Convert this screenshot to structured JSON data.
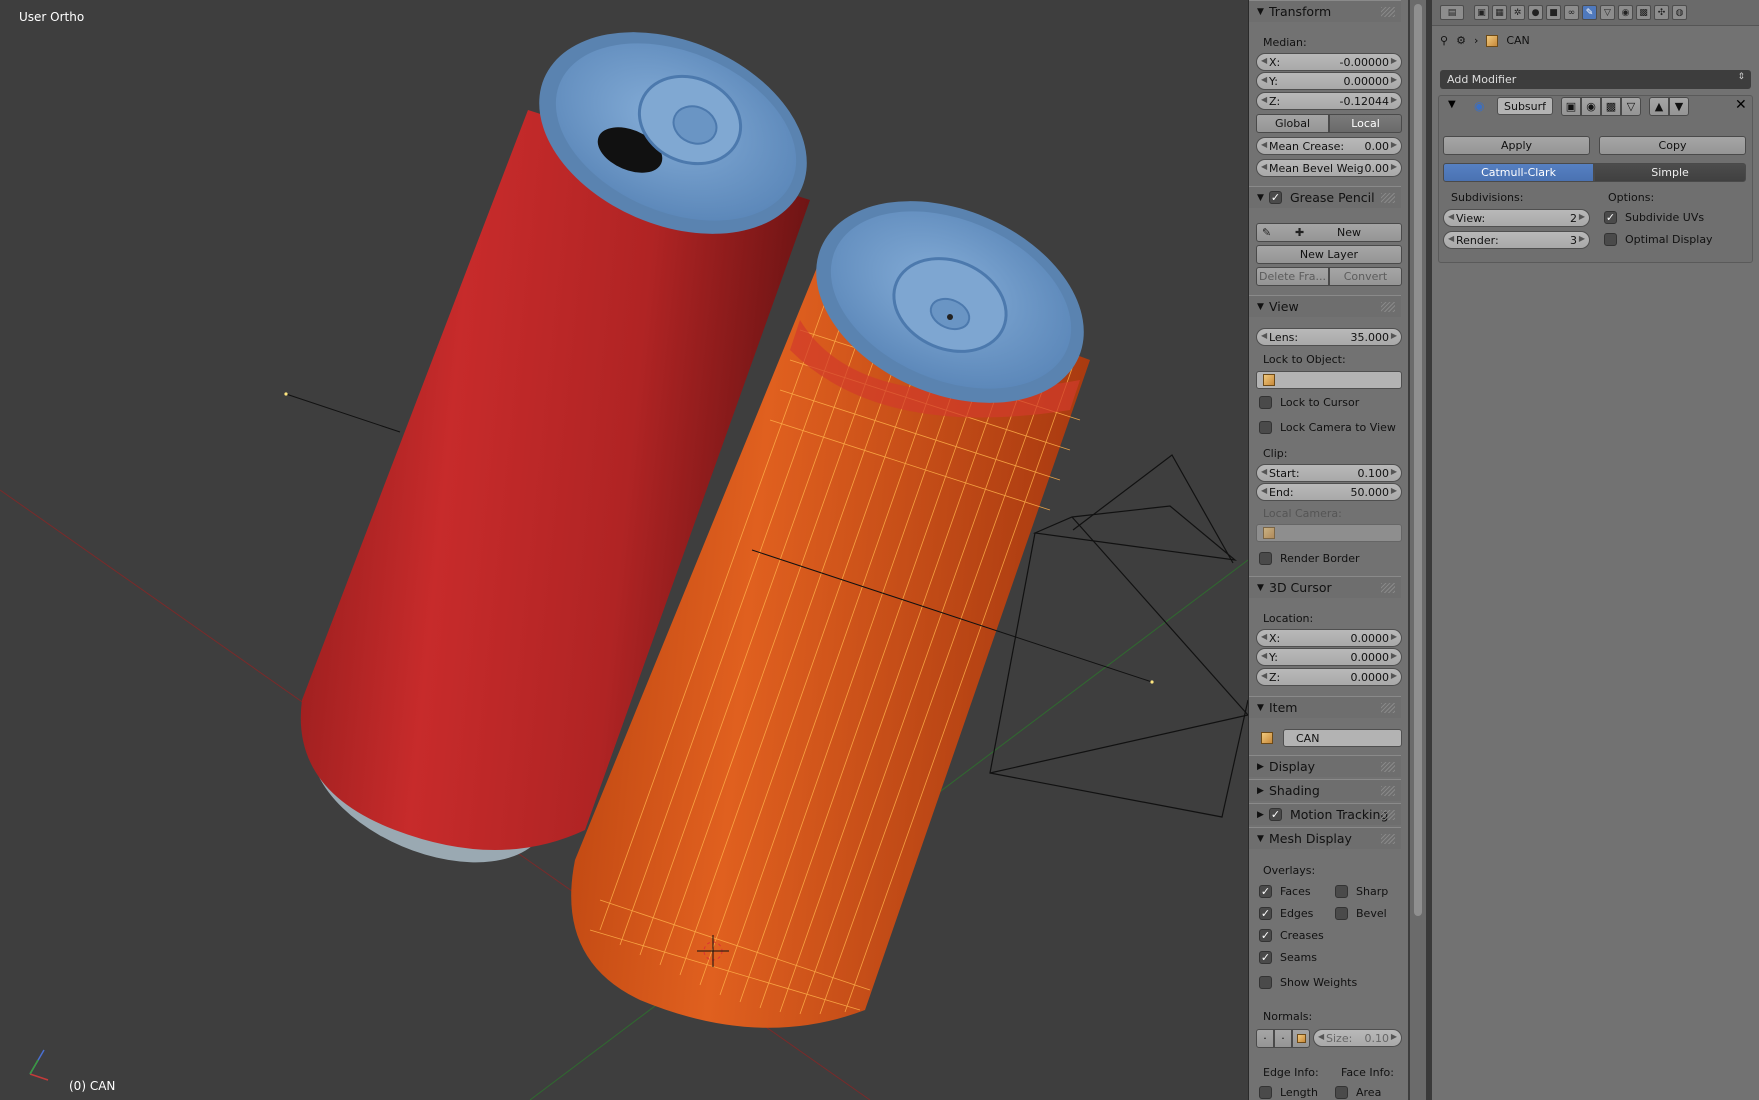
{
  "viewport": {
    "view_name": "User Ortho",
    "object_label": "(0) CAN"
  },
  "npanel": {
    "transform": {
      "title": "Transform",
      "median_label": "Median:",
      "x": {
        "label": "X:",
        "value": "-0.00000"
      },
      "y": {
        "label": "Y:",
        "value": "0.00000"
      },
      "z": {
        "label": "Z:",
        "value": "-0.12044"
      },
      "global_label": "Global",
      "local_label": "Local",
      "mean_crease": {
        "label": "Mean Crease:",
        "value": "0.00"
      },
      "mean_bevel": {
        "label": "Mean Bevel Weig:",
        "value": "0.00"
      }
    },
    "grease_pencil": {
      "title": "Grease Pencil",
      "new_label": "New",
      "new_layer_label": "New Layer",
      "delete_frame_label": "Delete Fra...",
      "convert_label": "Convert"
    },
    "view": {
      "title": "View",
      "lens": {
        "label": "Lens:",
        "value": "35.000"
      },
      "lock_to_object_label": "Lock to Object:",
      "lock_to_cursor_label": "Lock to Cursor",
      "lock_camera_label": "Lock Camera to View",
      "clip_label": "Clip:",
      "start": {
        "label": "Start:",
        "value": "0.100"
      },
      "end": {
        "label": "End:",
        "value": "50.000"
      },
      "local_camera_label": "Local Camera:",
      "render_border_label": "Render Border"
    },
    "cursor": {
      "title": "3D Cursor",
      "location_label": "Location:",
      "x": {
        "label": "X:",
        "value": "0.0000"
      },
      "y": {
        "label": "Y:",
        "value": "0.0000"
      },
      "z": {
        "label": "Z:",
        "value": "0.0000"
      }
    },
    "item": {
      "title": "Item",
      "name": "CAN"
    },
    "display_title": "Display",
    "shading_title": "Shading",
    "motion_tracking_title": "Motion Tracking",
    "mesh_display": {
      "title": "Mesh Display",
      "overlays_label": "Overlays:",
      "faces_label": "Faces",
      "sharp_label": "Sharp",
      "edges_label": "Edges",
      "bevel_label": "Bevel",
      "creases_label": "Creases",
      "seams_label": "Seams",
      "show_weights_label": "Show Weights",
      "normals_label": "Normals:",
      "size": {
        "label": "Size:",
        "value": "0.10"
      },
      "edge_info_label": "Edge Info:",
      "face_info_label": "Face Info:",
      "length_label": "Length",
      "area_label": "Area"
    }
  },
  "properties": {
    "breadcrumb_object": "CAN",
    "add_modifier_label": "Add Modifier",
    "modifier": {
      "name": "Subsurf",
      "apply_label": "Apply",
      "copy_label": "Copy",
      "catmull_label": "Catmull-Clark",
      "simple_label": "Simple",
      "subdivisions_label": "Subdivisions:",
      "options_label": "Options:",
      "view": {
        "label": "View:",
        "value": "2"
      },
      "render": {
        "label": "Render:",
        "value": "3"
      },
      "subdivide_uvs_label": "Subdivide UVs",
      "optimal_display_label": "Optimal Display"
    }
  },
  "colors": {
    "viewport_bg": "#3e3e3e",
    "panel_bg": "#727272",
    "can_red": "#c22a2a",
    "can_orange": "#d9561c",
    "lid_blue": "#6d98c8",
    "wire_orange": "#ffa531",
    "active_blue": "#5680c2"
  }
}
